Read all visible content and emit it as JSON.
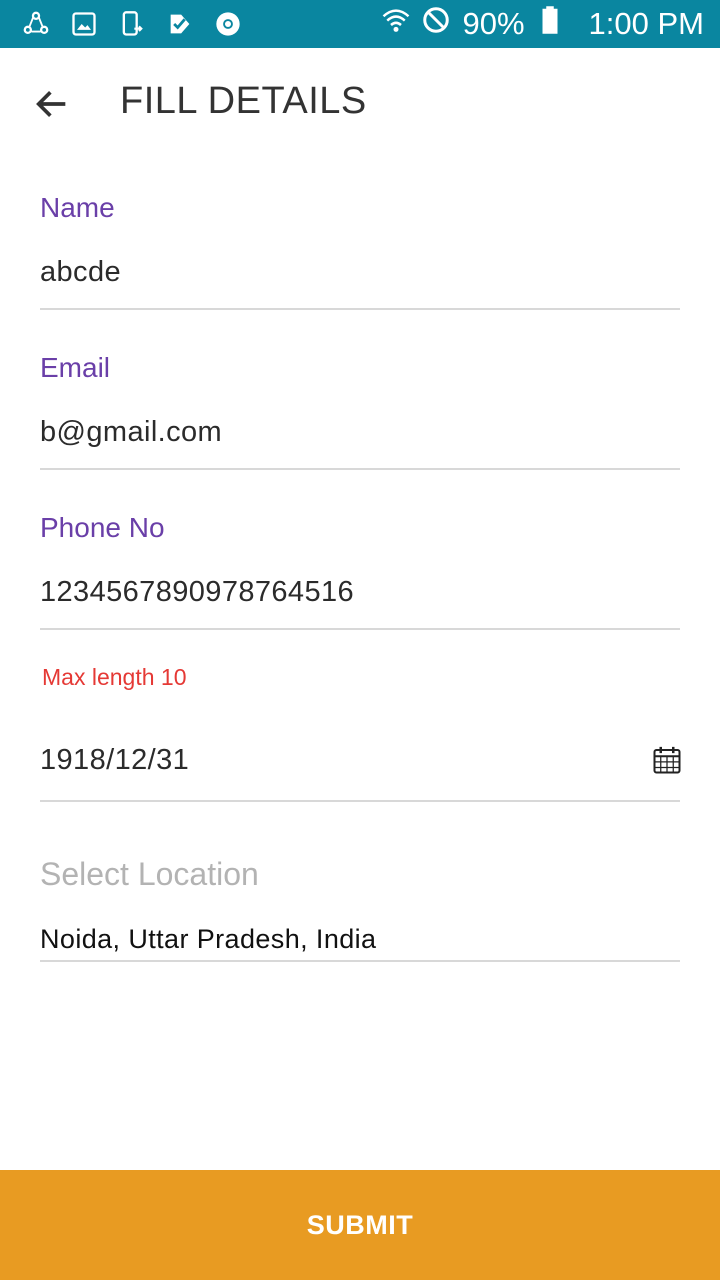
{
  "status_bar": {
    "icons": [
      "share-icon",
      "gallery-icon",
      "phone-transfer-icon",
      "check-box-icon",
      "chrome-icon"
    ],
    "wifi_icon": "wifi-icon",
    "dnd_icon": "do-not-disturb-icon",
    "battery": "90%",
    "battery_icon": "battery-icon",
    "time": "1:00 PM",
    "background_color": "#0a86a0"
  },
  "toolbar": {
    "back_icon": "back-arrow-icon",
    "title": "FILL DETAILS"
  },
  "form": {
    "name": {
      "label": "Name",
      "value": "abcde"
    },
    "email": {
      "label": "Email",
      "value": "b@gmail.com"
    },
    "phone": {
      "label": "Phone No",
      "value": "1234567890978764516",
      "error": "Max length 10"
    },
    "date": {
      "value": "1918/12/31",
      "icon": "calendar-icon"
    },
    "location": {
      "label": "Select Location",
      "value": "Noida, Uttar Pradesh, India"
    }
  },
  "submit": {
    "label": "SUBMIT",
    "color": "#e89b22"
  },
  "colors": {
    "label_purple": "#6a3fa8",
    "error_red": "#e53935"
  }
}
